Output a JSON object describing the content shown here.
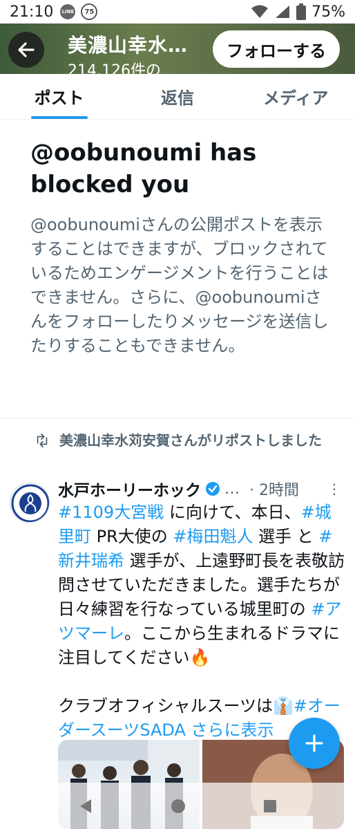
{
  "status_bar": {
    "time": "21:10",
    "line_badge": "LINE",
    "notification_count": "75",
    "battery": "75%"
  },
  "header": {
    "title": "美濃山幸水…",
    "subtitle": "214,126件の",
    "follow_label": "フォローする"
  },
  "tabs": [
    {
      "label": "ポスト",
      "active": true
    },
    {
      "label": "返信",
      "active": false
    },
    {
      "label": "メディア",
      "active": false
    }
  ],
  "blocked": {
    "heading": "@oobunoumi has blocked you",
    "description": "@oobunoumiさんの公開ポストを表示することはできますが、ブロックされているためエンゲージメントを行うことはできません。さらに、@oobunoumiさんをフォローしたりメッセージを送信したりすることもできません。"
  },
  "repost": {
    "text": "美濃山幸水苅安賀さんがリポストしました"
  },
  "tweet": {
    "name": "水戸ホーリーホック",
    "handle": "…",
    "time": "· 2時間",
    "body": [
      {
        "text": "#1109大宮戦",
        "tag": true
      },
      {
        "text": " に向けて、本日、",
        "tag": false
      },
      {
        "text": "#城里町",
        "tag": true
      },
      {
        "text": " PR大使の ",
        "tag": false
      },
      {
        "text": "#梅田魁人",
        "tag": true
      },
      {
        "text": " 選手 と ",
        "tag": false
      },
      {
        "text": "#新井瑞希",
        "tag": true
      },
      {
        "text": " 選手が、上遠野町長を表敬訪問させていただきました。選手たちが日々練習を行なっている城里町の ",
        "tag": false
      },
      {
        "text": "#アツマーレ",
        "tag": true
      },
      {
        "text": "。ここから生まれるドラマに注目してください🔥",
        "tag": false
      }
    ],
    "body2": [
      {
        "text": "クラブオフィシャルスーツは👔",
        "tag": false
      },
      {
        "text": "#オーダースーツSADA",
        "tag": true
      },
      {
        "text": " さらに表示",
        "tag": true
      }
    ]
  },
  "colors": {
    "accent": "#1d9bf0",
    "text_primary": "#0f1419",
    "text_secondary": "#536471"
  },
  "icons": {
    "back": "arrow-left-icon",
    "verified": "verified-badge-icon",
    "repost": "repost-icon",
    "more": "more-vertical-icon",
    "compose": "plus-icon"
  }
}
